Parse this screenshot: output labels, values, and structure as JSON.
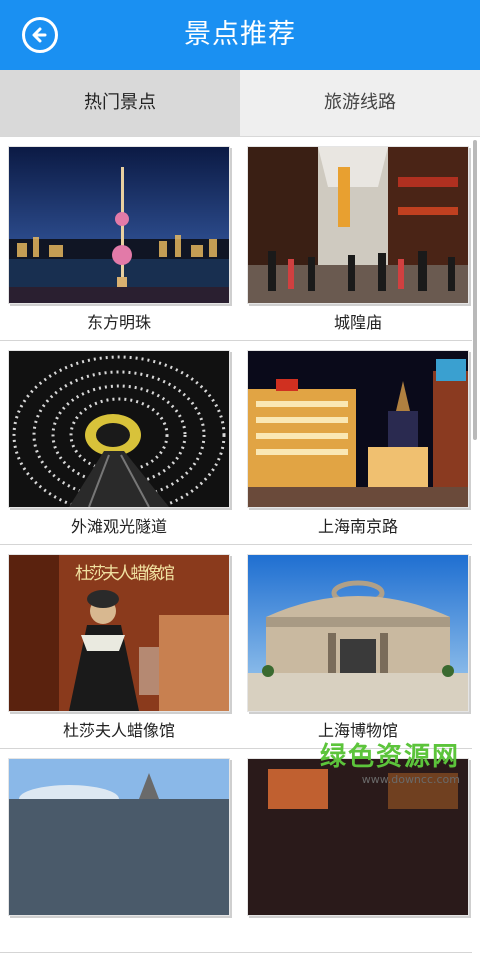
{
  "header": {
    "title": "景点推荐",
    "back_icon": "back-arrow-icon"
  },
  "tabs": [
    {
      "label": "热门景点",
      "active": true
    },
    {
      "label": "旅游线路",
      "active": false
    }
  ],
  "attractions": [
    {
      "name": "东方明珠"
    },
    {
      "name": "城隍庙"
    },
    {
      "name": "外滩观光隧道"
    },
    {
      "name": "上海南京路"
    },
    {
      "name": "杜莎夫人蜡像馆"
    },
    {
      "name": "上海博物馆"
    }
  ],
  "photo_text": {
    "madame_tussauds_sign": "杜莎夫人蜡像馆"
  },
  "watermark": {
    "text": "绿色资源网",
    "url": "www.downcc.com"
  },
  "colors": {
    "header": "#1a90f2",
    "tab_active": "#d9d9d9",
    "tab_inactive": "#efefef",
    "watermark": "#5cc43b"
  }
}
